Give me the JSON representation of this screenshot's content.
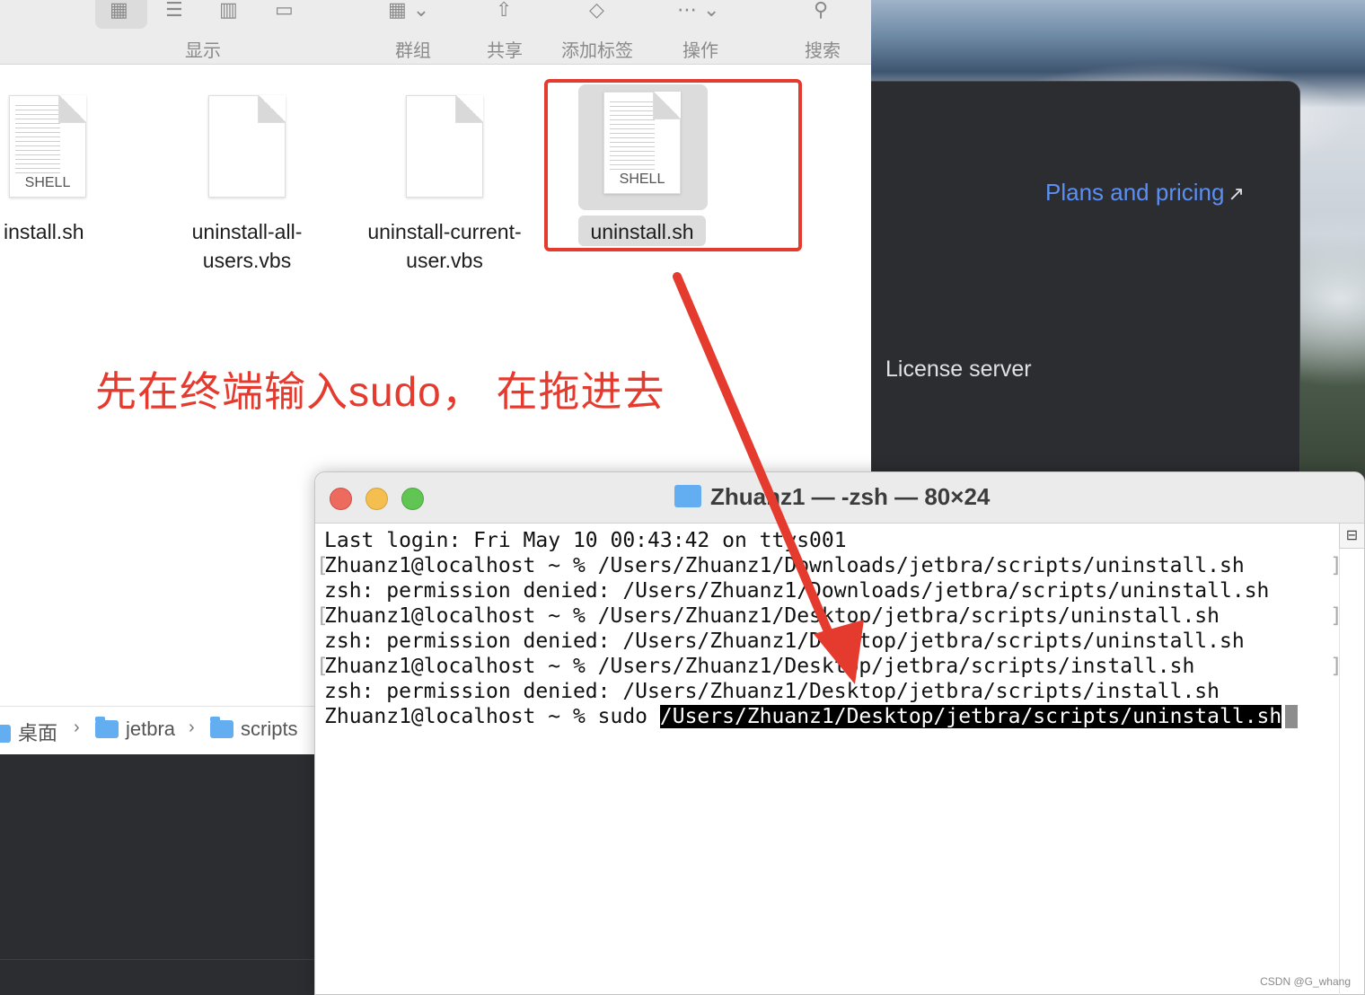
{
  "finder": {
    "toolbar": {
      "view_label": "显示",
      "group_label": "群组",
      "share_label": "共享",
      "tag_label": "添加标签",
      "action_label": "操作",
      "search_label": "搜索"
    },
    "files": [
      {
        "name": "install.sh",
        "badge": "SHELL"
      },
      {
        "name_line1": "uninstall-all-",
        "name_line2": "users.vbs"
      },
      {
        "name_line1": "uninstall-current-",
        "name_line2": "user.vbs"
      },
      {
        "name": "uninstall.sh",
        "badge": "SHELL",
        "selected": true
      }
    ],
    "pathbar": {
      "items": [
        "桌面",
        "jetbra",
        "scripts"
      ]
    }
  },
  "annotation": {
    "caption": "先在终端输入sudo， 在拖进去",
    "color": "#e53a2e"
  },
  "ide": {
    "plans_link": "Plans and pricing",
    "plans_arrow": "↗",
    "license_server": "License server"
  },
  "terminal": {
    "title": "Zhuanz1 — -zsh — 80×24",
    "lines": [
      "Last login: Fri May 10 00:43:42 on ttys001",
      "Zhuanz1@localhost ~ % /Users/Zhuanz1/Downloads/jetbra/scripts/uninstall.sh",
      "zsh: permission denied: /Users/Zhuanz1/Downloads/jetbra/scripts/uninstall.sh",
      "Zhuanz1@localhost ~ % /Users/Zhuanz1/Desktop/jetbra/scripts/uninstall.sh",
      "zsh: permission denied: /Users/Zhuanz1/Desktop/jetbra/scripts/uninstall.sh",
      "Zhuanz1@localhost ~ % /Users/Zhuanz1/Desktop/jetbra/scripts/install.sh",
      "zsh: permission denied: /Users/Zhuanz1/Desktop/jetbra/scripts/install.sh"
    ],
    "prompt": "Zhuanz1@localhost ~ % sudo ",
    "current_input": "/Users/Zhuanz1/Desktop/jetbra/scripts/uninstall.sh"
  },
  "watermark": "CSDN @G_whang"
}
